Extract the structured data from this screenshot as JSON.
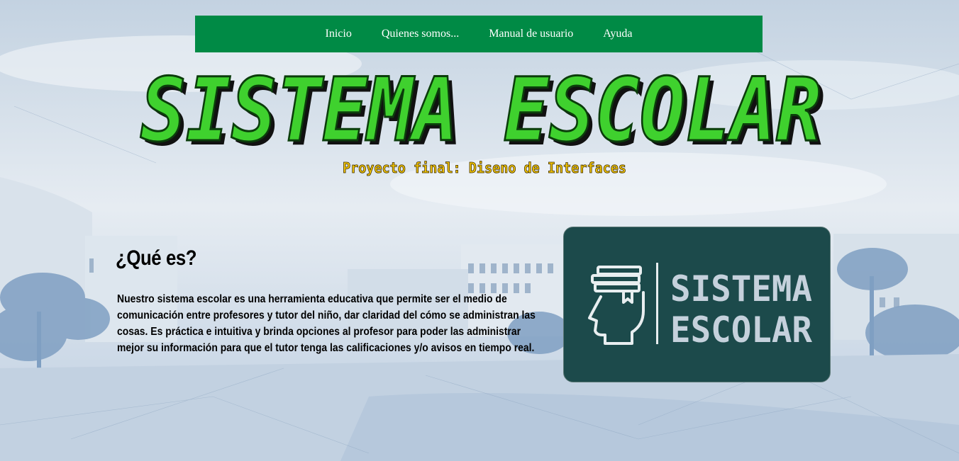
{
  "nav": {
    "items": [
      {
        "label": "Inicio"
      },
      {
        "label": "Quienes somos..."
      },
      {
        "label": "Manual de usuario"
      },
      {
        "label": "Ayuda"
      }
    ]
  },
  "hero": {
    "title": "SISTEMA ESCOLAR",
    "subtitle": "Proyecto final: Diseno de Interfaces"
  },
  "about": {
    "heading": "¿Qué es?",
    "body": "Nuestro sistema escolar es una herramienta educativa que permite ser el medio de comunicación entre profesores y tutor del niño, dar claridad del cómo se administran las cosas. Es práctica e intuitiva y brinda opciones al profesor para poder las administrar mejor su información para que el tutor tenga las calificaciones y/o avisos en tiempo real."
  },
  "logo": {
    "line1": "SISTEMA",
    "line2": "ESCOLAR",
    "icon": "head-with-books-icon"
  },
  "colors": {
    "nav_bg": "#008a45",
    "title_green": "#3fd12e",
    "subtitle_yellow": "#f2c400",
    "logo_bg": "#1c4a4b"
  }
}
